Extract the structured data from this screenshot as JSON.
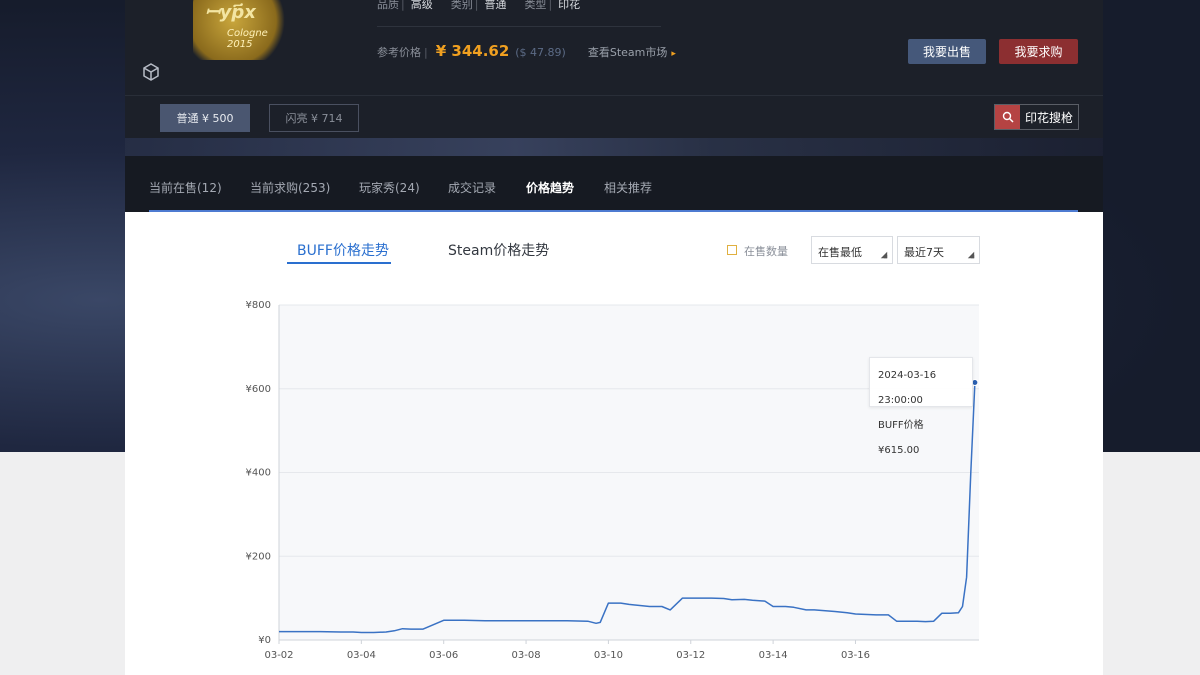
{
  "item": {
    "art_text_1": "ꟷyp҃x",
    "art_text_2": "Cologne 2015",
    "quality_label": "品质",
    "quality_value": "高级",
    "category_label": "类别",
    "category_value": "普通",
    "type_label": "类型",
    "type_value": "印花",
    "ref_price_label": "参考价格",
    "ref_price_cny": "¥ 344.62",
    "ref_price_usd": "($ 47.89)",
    "steam_market_link": "查看Steam市场",
    "sell_button": "我要出售",
    "buy_button": "我要求购"
  },
  "variants": {
    "normal": "普通 ¥ 500",
    "flash": "闪亮 ¥ 714",
    "sticker_search": "印花搜枪"
  },
  "tabs": [
    {
      "label": "当前在售(12)"
    },
    {
      "label": "当前求购(253)"
    },
    {
      "label": "玩家秀(24)"
    },
    {
      "label": "成交记录"
    },
    {
      "label": "价格趋势"
    },
    {
      "label": "相关推荐"
    }
  ],
  "trend": {
    "buff_tab": "BUFF价格走势",
    "steam_tab": "Steam价格走势",
    "checkbox_label": "在售数量",
    "filter_price": "在售最低",
    "filter_range": "最近7天"
  },
  "tooltip": {
    "time": "2024-03-16 23:00:00",
    "value": "BUFF价格 ¥615.00"
  },
  "colors": {
    "accent": "#2a6fcf",
    "price": "#f0a020",
    "sell": "#45587a",
    "buy": "#8c2f31"
  },
  "chart_data": {
    "type": "line",
    "title": "",
    "xlabel": "",
    "ylabel": "",
    "ylim": [
      0,
      800
    ],
    "yticks": [
      "¥0",
      "¥200",
      "¥400",
      "¥600",
      "¥800"
    ],
    "xticks": [
      "03-02",
      "03-04",
      "03-06",
      "03-08",
      "03-10",
      "03-12",
      "03-14",
      "03-16"
    ],
    "grid": true,
    "series": [
      {
        "name": "",
        "x": [
          0.0,
          0.5,
          1.0,
          1.5,
          1.8,
          2.0,
          2.3,
          2.6,
          2.8,
          3.0,
          3.2,
          3.5,
          4.0,
          4.5,
          5.0,
          5.5,
          6.0,
          6.5,
          7.0,
          7.5,
          7.7,
          7.8,
          8.0,
          8.3,
          8.5,
          9.0,
          9.3,
          9.5,
          9.8,
          10.0,
          10.5,
          10.8,
          11.0,
          11.3,
          11.5,
          11.8,
          12.0,
          12.3,
          12.5,
          12.8,
          13.0,
          13.5,
          13.8,
          14.0,
          14.5,
          14.8,
          15.0,
          15.5,
          15.7,
          15.9,
          16.1,
          16.3,
          16.5,
          16.6,
          16.7,
          16.8,
          16.9
        ],
        "y": [
          20,
          20,
          20,
          19,
          19,
          18,
          18,
          19,
          22,
          27,
          26,
          26,
          47,
          47,
          46,
          46,
          46,
          46,
          46,
          45,
          40,
          42,
          88,
          88,
          85,
          80,
          80,
          72,
          100,
          100,
          100,
          99,
          96,
          97,
          95,
          93,
          80,
          80,
          78,
          72,
          72,
          68,
          65,
          62,
          60,
          60,
          45,
          45,
          44,
          45,
          64,
          64,
          65,
          80,
          150,
          400,
          615
        ]
      }
    ]
  }
}
